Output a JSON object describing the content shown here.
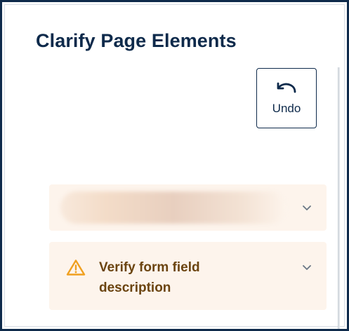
{
  "page": {
    "title": "Clarify Page Elements"
  },
  "toolbar": {
    "undo_label": "Undo",
    "undo_icon": "undo-arrow-icon"
  },
  "panels": [
    {
      "label": "",
      "redacted": true,
      "icon": "chevron-down-icon"
    },
    {
      "label": "Verify form field description",
      "status_icon": "warning-icon",
      "icon": "chevron-down-icon"
    }
  ],
  "colors": {
    "navy": "#0e2a4b",
    "panel_bg": "#fdf4ec",
    "warning": "#f0a020",
    "warning_text": "#6b4410"
  }
}
